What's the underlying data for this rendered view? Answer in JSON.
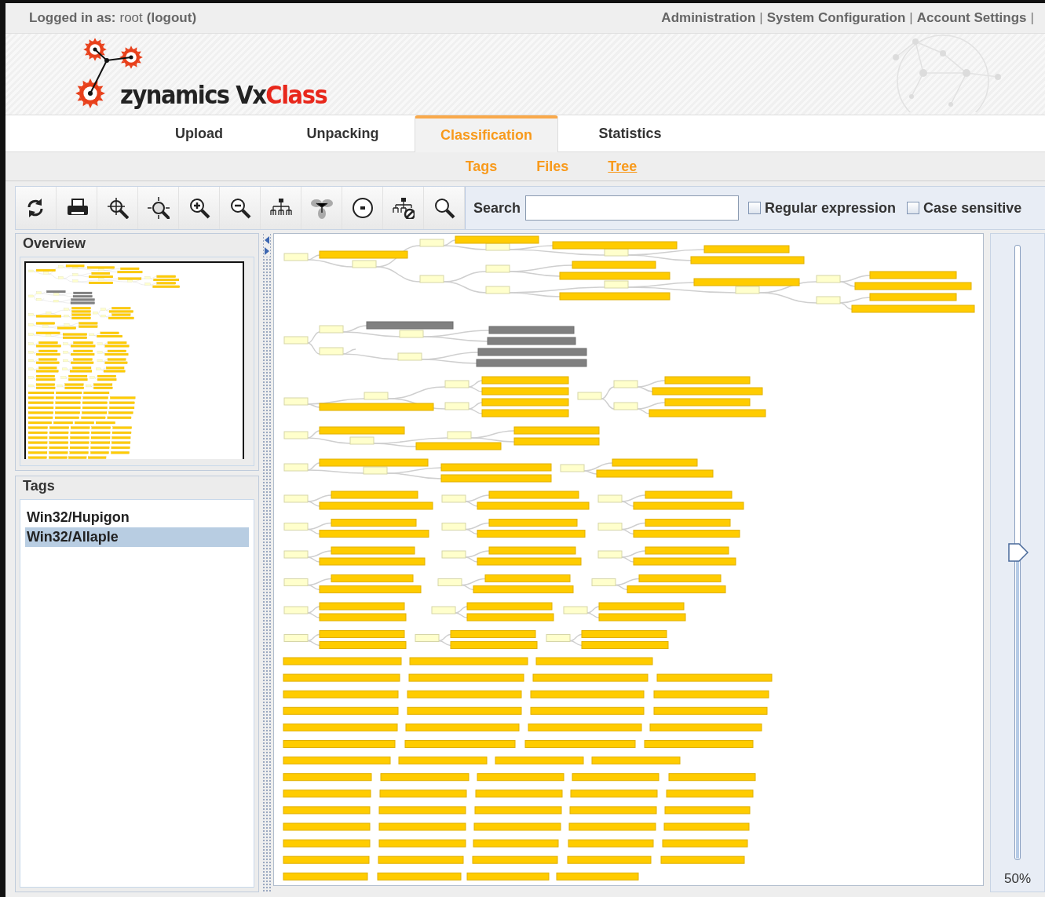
{
  "session": {
    "label": "Logged in as:",
    "user": "root",
    "logout": "(logout)"
  },
  "top_links": [
    {
      "label": "Administration",
      "separator": "|"
    },
    {
      "label": "System Configuration",
      "separator": "|"
    },
    {
      "label": "Account Settings",
      "separator": "|"
    }
  ],
  "logo": {
    "text_a": "zynamics Vx",
    "text_b": "Class"
  },
  "tabs": [
    {
      "label": "Upload",
      "selected": false
    },
    {
      "label": "Unpacking",
      "selected": false
    },
    {
      "label": "Classification",
      "selected": true
    },
    {
      "label": "Statistics",
      "selected": false
    }
  ],
  "subtabs": [
    {
      "label": "Tags",
      "selected": false
    },
    {
      "label": "Files",
      "selected": false
    },
    {
      "label": "Tree",
      "selected": true
    }
  ],
  "toolbar": {
    "search_label": "Search",
    "checkboxes": [
      {
        "label": "Regular expression",
        "checked": false
      },
      {
        "label": "Case sensitive",
        "checked": false
      }
    ]
  },
  "overview": {
    "title": "Overview"
  },
  "tags": {
    "title": "Tags",
    "items": [
      {
        "label": "Win32/Hupigon",
        "selected": false
      },
      {
        "label": "Win32/Allaple",
        "selected": true
      }
    ]
  },
  "zoom": {
    "level": 0.5,
    "reading": "50%"
  }
}
